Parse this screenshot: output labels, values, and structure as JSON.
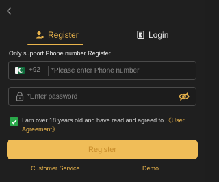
{
  "nav": {
    "back_icon": "chevron-left-icon"
  },
  "tabs": [
    {
      "label": "Register",
      "icon": "user-icon",
      "active": true
    },
    {
      "label": "Login",
      "icon": "login-door-icon",
      "active": false
    }
  ],
  "form": {
    "hint": "Only support Phone number Register",
    "phone": {
      "country_code": "+92",
      "placeholder": "*Please enter Phone number",
      "value": ""
    },
    "password": {
      "placeholder": "*Enter password",
      "value": ""
    }
  },
  "agreement": {
    "checked": true,
    "text": "I am over 18 years old and have read and agreed to",
    "link_label": "《User Agreement》"
  },
  "actions": {
    "register_label": "Register",
    "customer_service": "Customer Service",
    "demo": "Demo"
  },
  "colors": {
    "accent": "#e9b44c",
    "button": "#f0bd58",
    "checkbox": "#2aa84a",
    "background": "#1f1f1f"
  }
}
